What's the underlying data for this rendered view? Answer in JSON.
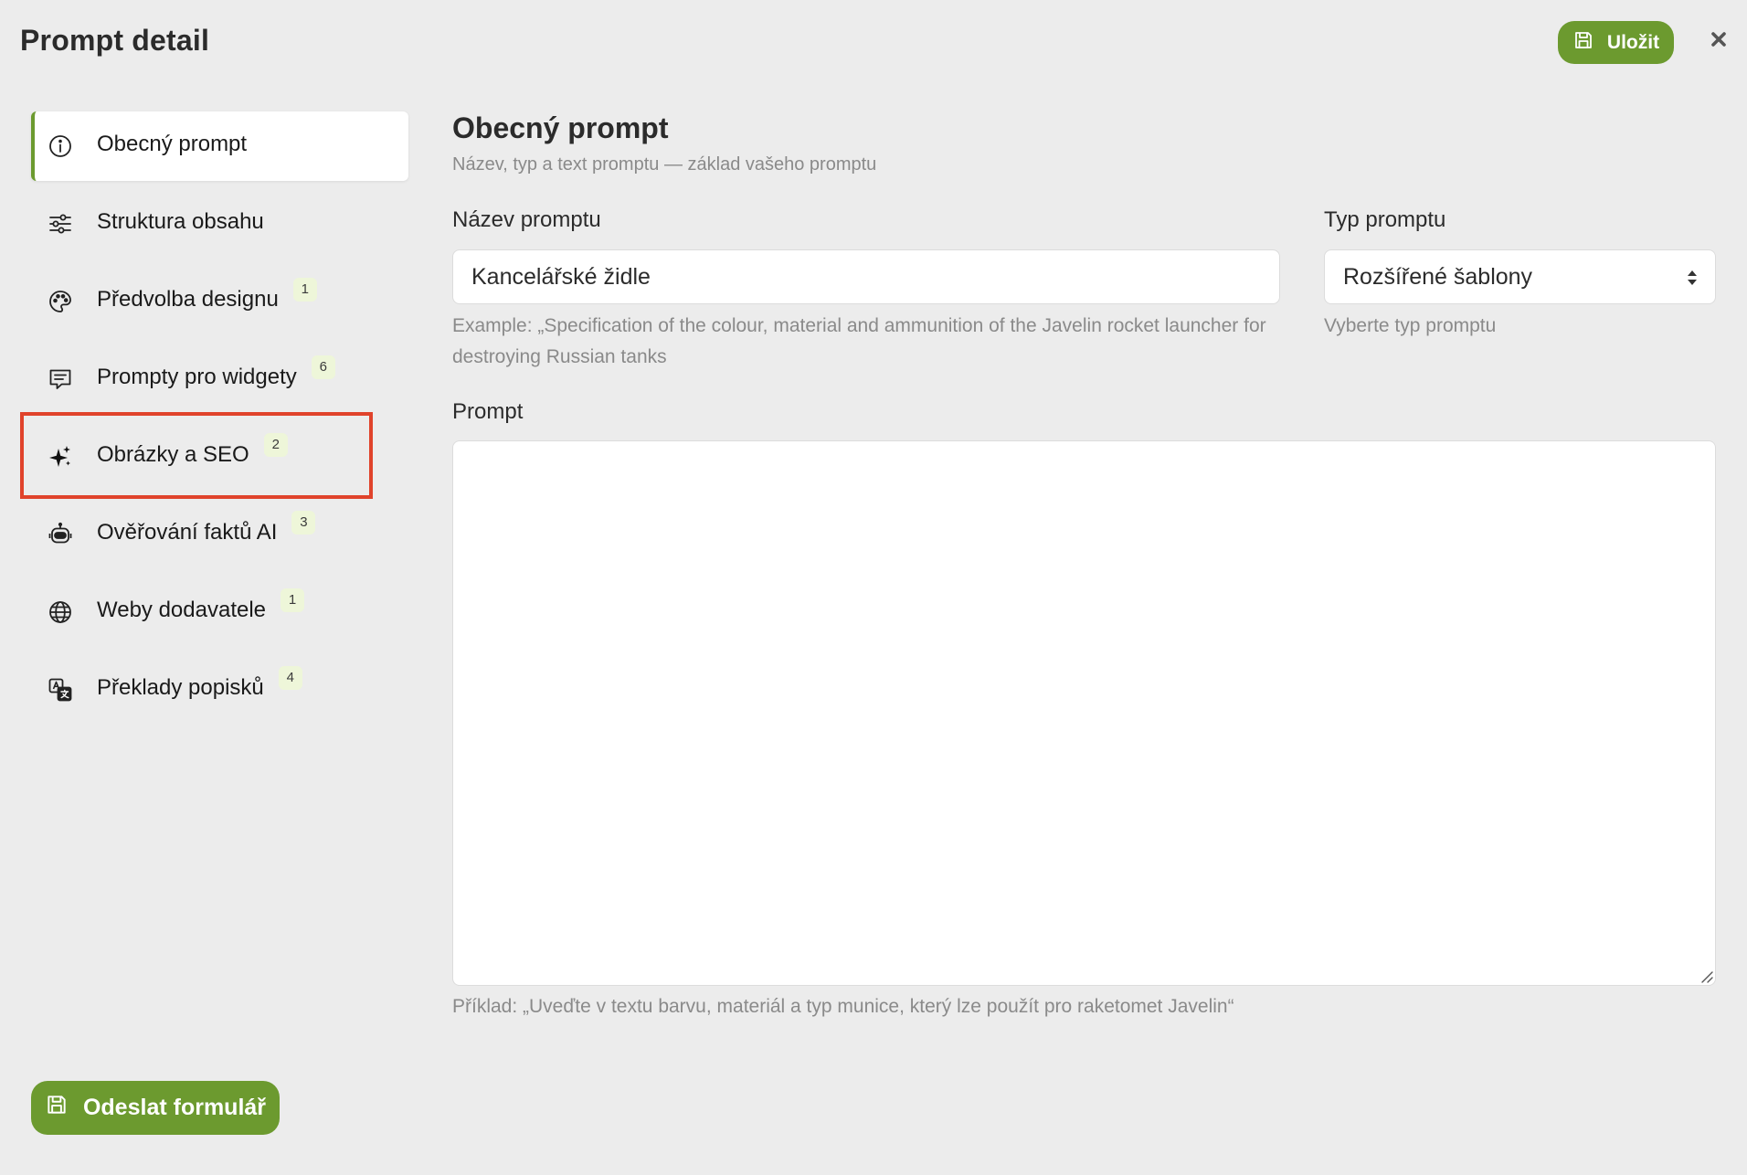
{
  "header": {
    "title": "Prompt detail",
    "save_label": "Uložit",
    "accent_color": "#6c9a2f"
  },
  "sidebar": {
    "items": [
      {
        "label": "Obecný prompt",
        "icon": "info-icon",
        "badge": null,
        "active": true
      },
      {
        "label": "Struktura obsahu",
        "icon": "sliders-icon",
        "badge": null,
        "active": false
      },
      {
        "label": "Předvolba designu",
        "icon": "palette-icon",
        "badge": "1",
        "active": false
      },
      {
        "label": "Prompty pro widgety",
        "icon": "message-icon",
        "badge": "6",
        "active": false
      },
      {
        "label": "Obrázky a SEO",
        "icon": "sparkles-icon",
        "badge": "2",
        "active": false,
        "highlighted": true
      },
      {
        "label": "Ověřování faktů AI",
        "icon": "robot-icon",
        "badge": "3",
        "active": false
      },
      {
        "label": "Weby dodavatele",
        "icon": "globe-icon",
        "badge": "1",
        "active": false
      },
      {
        "label": "Překlady popisků",
        "icon": "translate-icon",
        "badge": "4",
        "active": false
      }
    ],
    "submit_label": "Odeslat formulář",
    "highlight_color": "#e0432b"
  },
  "main": {
    "title": "Obecný prompt",
    "subtitle": "Název, typ a text promptu — základ vašeho promptu",
    "name_field": {
      "label": "Název promptu",
      "value": "Kancelářské židle",
      "hint": "Example: „Specification of the colour, material and ammunition of the Javelin rocket launcher for destroying Russian tanks"
    },
    "type_field": {
      "label": "Typ promptu",
      "value": "Rozšířené šablony",
      "hint": "Vyberte typ promptu"
    },
    "prompt_field": {
      "label": "Prompt",
      "value": "",
      "hint": "Příklad: „Uveďte v textu barvu, materiál a typ munice, který lze použít pro raketomet Javelin“"
    }
  }
}
